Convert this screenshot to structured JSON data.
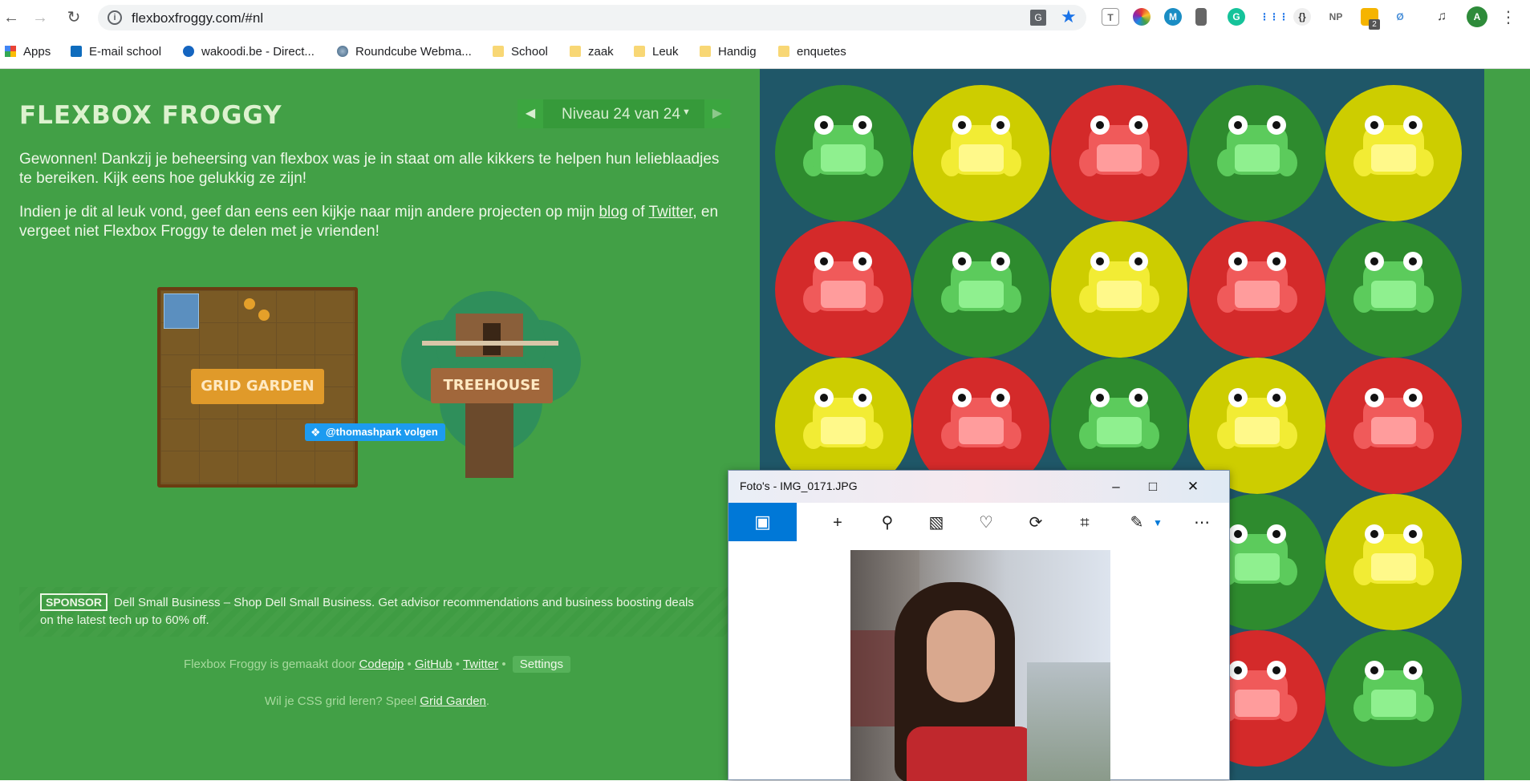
{
  "browser": {
    "url": "flexboxfroggy.com/#nl",
    "bookmarks": [
      {
        "label": "Apps"
      },
      {
        "label": "E-mail school"
      },
      {
        "label": "wakoodi.be - Direct..."
      },
      {
        "label": "Roundcube Webma..."
      },
      {
        "label": "School"
      },
      {
        "label": "zaak"
      },
      {
        "label": "Leuk"
      },
      {
        "label": "Handig"
      },
      {
        "label": "enquetes"
      }
    ],
    "extensions": [
      "T",
      "NP",
      "2",
      "A"
    ]
  },
  "game": {
    "title": "FLEXBOX FROGGY",
    "level_label": "Niveau 24 van 24",
    "intro_1": "Gewonnen! Dankzij je beheersing van flexbox was je in staat om alle kikkers te helpen hun lelieblaadjes te bereiken. Kijk eens hoe gelukkig ze zijn!",
    "intro_2_before": "Indien je dit al leuk vond, geef dan eens een kijkje naar mijn andere projecten op mijn ",
    "blog_link": "blog",
    "intro_2_mid": " of ",
    "twitter_link": "Twitter",
    "intro_2_after": ", en vergeet niet Flexbox Froggy te delen met je vrienden!",
    "grid_garden_label": "GRID GARDEN",
    "treehouse_label": "TREEHOUSE",
    "follow_label": "@thomashpark volgen",
    "sponsor_badge": "SPONSOR",
    "sponsor_text": "Dell Small Business – Shop Dell Small Business. Get advisor recommendations and business boosting deals on the latest tech up to 60% off.",
    "footer_prefix": "Flexbox Froggy is gemaakt door",
    "footer_codepip": "Codepip",
    "footer_github": "GitHub",
    "footer_twitter": "Twitter",
    "footer_settings": "Settings",
    "footer2_prefix": "Wil je CSS grid leren? Speel",
    "footer2_link": "Grid Garden",
    "pads": [
      [
        "green",
        "yellow",
        "red",
        "green",
        "yellow"
      ],
      [
        "red",
        "green",
        "yellow",
        "red",
        "green"
      ],
      [
        "yellow",
        "red",
        "green",
        "yellow",
        "red"
      ],
      [
        "",
        "",
        "",
        "green",
        "yellow"
      ],
      [
        "",
        "",
        "",
        "red",
        "green"
      ]
    ]
  },
  "photos_app": {
    "title": "Foto's - IMG_0171.JPG"
  }
}
